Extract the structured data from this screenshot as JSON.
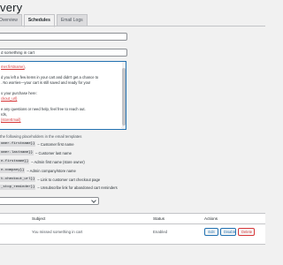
{
  "header": {
    "title": "very"
  },
  "tabs": [
    {
      "label": "Overview"
    },
    {
      "label": "Schedules"
    },
    {
      "label": "Email Logs"
    }
  ],
  "form": {
    "field1_value": "",
    "subject_value": "d something in cart"
  },
  "editor": {
    "lines": [
      {
        "pre": "",
        "ph": "mer.firstname}",
        "post": ","
      },
      {
        "pre": "",
        "ph": "",
        "post": ""
      },
      {
        "pre": "d you left a few items in your cart and didn't get a chance to",
        "ph": "",
        "post": ""
      },
      {
        "pre": ". No worries—your cart is still saved and ready for you!",
        "ph": "",
        "post": ""
      },
      {
        "pre": "",
        "ph": "",
        "post": ""
      },
      {
        "pre": "o your purchase here:",
        "ph": "",
        "post": ""
      },
      {
        "pre": "",
        "ph": "ckout_url}",
        "post": ""
      },
      {
        "pre": "",
        "ph": "",
        "post": ""
      },
      {
        "pre": "e any questions or need help, feel free to reach out.",
        "ph": "",
        "post": ""
      },
      {
        "pre": "rds,",
        "ph": "",
        "post": ""
      },
      {
        "pre": "",
        "ph": "{storeEmail}",
        "post": ""
      }
    ]
  },
  "placeholders": {
    "help": "the following placeholders in the email templates",
    "items": [
      {
        "code": "omer.firstname}}",
        "desc": "– Customer first name"
      },
      {
        "code": "omer.lastname}}",
        "desc": "– Customer last name"
      },
      {
        "code": "n.firstname}}",
        "desc": "– Admin first name (store owner)"
      },
      {
        "code": "n.company}}",
        "desc": "– Admin company/store name"
      },
      {
        "code": "t.checkout_url}}",
        "desc": "– Link to customer cart checkout page"
      },
      {
        "code": "_stop_reminder}}",
        "desc": "– Unsubscribe link for abandoned cart reminders"
      }
    ]
  },
  "select": {
    "value": ""
  },
  "table": {
    "headers": {
      "subject": "Subject",
      "status": "Status",
      "actions": "Actions"
    },
    "rows": [
      {
        "subject": "You missed something in cart",
        "status": "Enabled",
        "edit": "Edit",
        "disable": "Disable",
        "delete": "Delete"
      }
    ]
  },
  "colors": {
    "accent": "#2271b1",
    "danger": "#d63638",
    "background": "#f1f1f1"
  }
}
